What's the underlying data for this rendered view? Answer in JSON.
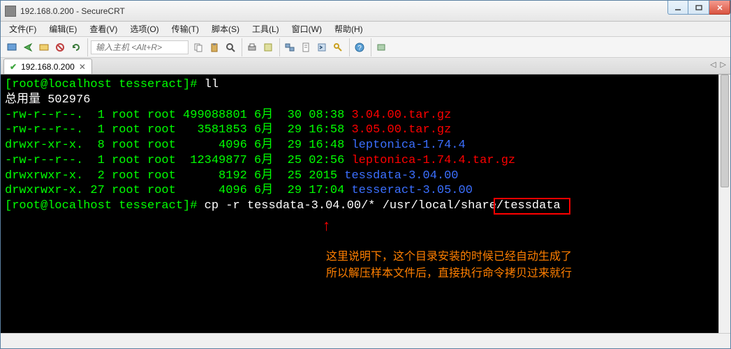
{
  "window": {
    "title": "192.168.0.200 - SecureCRT"
  },
  "menu": {
    "file": "文件(F)",
    "edit": "编辑(E)",
    "view": "查看(V)",
    "options": "选项(O)",
    "transfer": "传输(T)",
    "script": "脚本(S)",
    "tools": "工具(L)",
    "window": "窗口(W)",
    "help": "帮助(H)"
  },
  "toolbar": {
    "host_placeholder": "输入主机 <Alt+R>"
  },
  "tab": {
    "label": "192.168.0.200",
    "connected": "✔",
    "close": "✕"
  },
  "terminal": {
    "prompt1_user": "[root@localhost tesseract]#",
    "prompt1_cmd": " ll",
    "total": "总用量 502976",
    "rows": [
      {
        "perm": "-rw-r--r--.  1 root root 499088801 6月  30 08:38 ",
        "name": "3.04.00.tar.gz",
        "color": "red"
      },
      {
        "perm": "-rw-r--r--.  1 root root   3581853 6月  29 16:58 ",
        "name": "3.05.00.tar.gz",
        "color": "red"
      },
      {
        "perm": "drwxr-xr-x.  8 root root      4096 6月  29 16:48 ",
        "name": "leptonica-1.74.4",
        "color": "blue"
      },
      {
        "perm": "-rw-r--r--.  1 root root  12349877 6月  25 02:56 ",
        "name": "leptonica-1.74.4.tar.gz",
        "color": "red"
      },
      {
        "perm": "drwxrwxr-x.  2 root root      8192 6月  25 2015 ",
        "name": "tessdata-3.04.00",
        "color": "blue"
      },
      {
        "perm": "drwxrwxr-x. 27 root root      4096 6月  29 17:04 ",
        "name": "tesseract-3.05.00",
        "color": "blue"
      }
    ],
    "prompt2_user": "[root@localhost tesseract]#",
    "prompt2_cmd": " cp -r tessdata-3.04.00/* /usr/local/share/tessdata"
  },
  "annotations": {
    "arrow": "↑",
    "boxed_text": "tessdata",
    "note_line1": "这里说明下，这个目录安装的时候已经自动生成了",
    "note_line2": "所以解压样本文件后，直接执行命令拷贝过来就行"
  }
}
